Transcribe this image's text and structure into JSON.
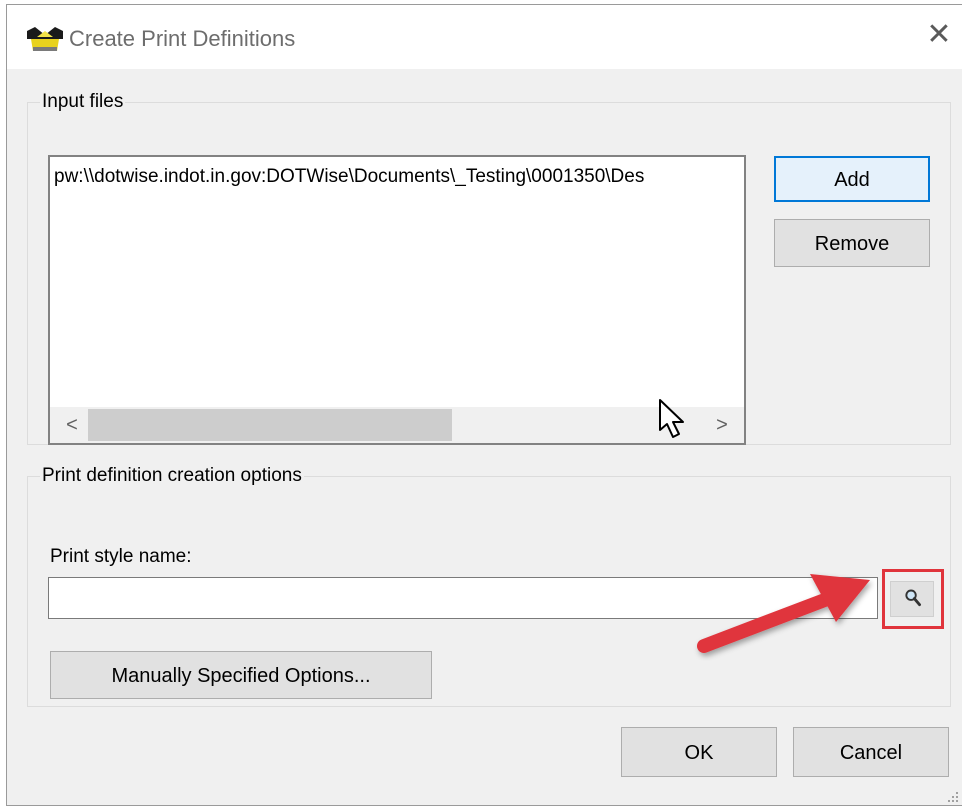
{
  "window": {
    "title": "Create Print Definitions",
    "close_label": "✕"
  },
  "input_files": {
    "legend": "Input files",
    "files": [
      "pw:\\\\dotwise.indot.in.gov:DOTWise\\Documents\\_Testing\\0001350\\Des"
    ],
    "scroll_left": "<",
    "scroll_right": ">",
    "add_label": "Add",
    "remove_label": "Remove"
  },
  "options": {
    "legend": "Print definition creation options",
    "style_label": "Print style name:",
    "style_value": "",
    "manual_label": "Manually Specified Options..."
  },
  "footer": {
    "ok_label": "OK",
    "cancel_label": "Cancel"
  },
  "colors": {
    "annotation_red": "#e0343c",
    "focus_blue": "#0078d7"
  },
  "icons": {
    "browse": "magnifier-icon",
    "app": "app-logo-icon"
  }
}
